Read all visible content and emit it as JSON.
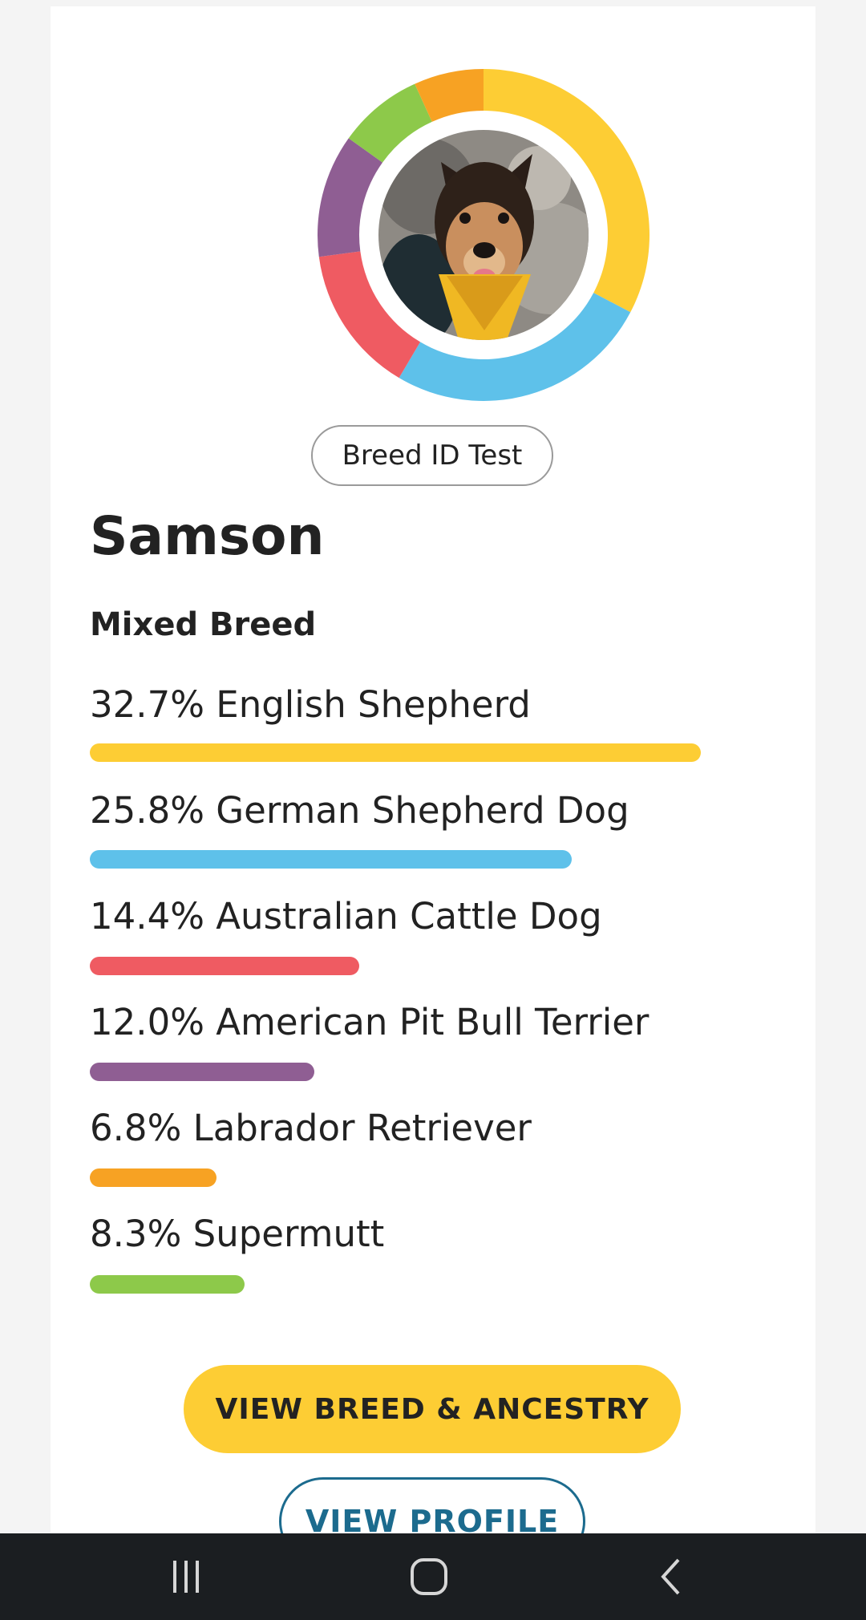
{
  "test_badge": "Breed ID Test",
  "dog": {
    "name": "Samson",
    "breed_type": "Mixed Breed",
    "photo_alt": "Dog photo"
  },
  "breeds": [
    {
      "label": "32.7% English Shepherd",
      "percent": 32.7,
      "color": "#fdcd34"
    },
    {
      "label": "25.8% German Shepherd Dog",
      "percent": 25.8,
      "color": "#5ec1ea"
    },
    {
      "label": "14.4% Australian Cattle Dog",
      "percent": 14.4,
      "color": "#ef5b62"
    },
    {
      "label": "12.0% American Pit Bull Terrier",
      "percent": 12.0,
      "color": "#8f5e93"
    },
    {
      "label": "6.8% Labrador Retriever",
      "percent": 6.8,
      "color": "#f7a223"
    },
    {
      "label": "8.3% Supermutt",
      "percent": 8.3,
      "color": "#8dc94a"
    }
  ],
  "buttons": {
    "breed_ancestry": "VIEW BREED & ANCESTRY",
    "profile": "VIEW PROFILE"
  },
  "system_nav": {
    "recents_icon": "recents-icon",
    "home_icon": "home-icon",
    "back_icon": "back-icon"
  }
}
